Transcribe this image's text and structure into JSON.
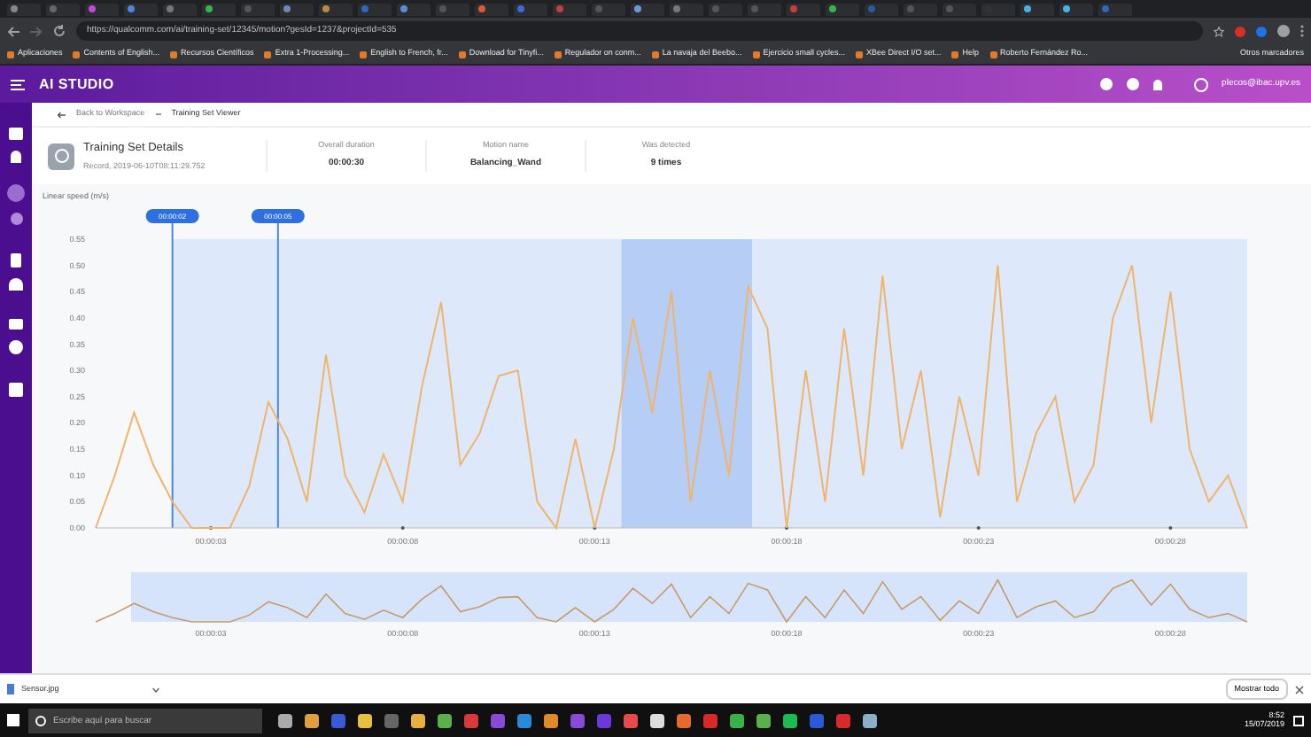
{
  "browser": {
    "url": "https://qualcomm.com/ai/training-set/12345/motion?gesId=1237&projectId=535",
    "bookmarks": [
      "Aplicaciones",
      "Contents of English...",
      "Recursos Científicos",
      "Extra 1-Processing...",
      "English to French, fr...",
      "Download for Tinyfi...",
      "Regulador on conm...",
      "La navaja del Beebo...",
      "Ejercicio small cycles...",
      "XBee Direct I/O set...",
      "Help",
      "Roberto Fernández Ro..."
    ],
    "other_bookmarks": "Otros marcadores"
  },
  "app": {
    "logo": "AI STUDIO",
    "user": "plecos@ibac.upv.es"
  },
  "breadcrumb": [
    "Back to Workspace",
    "Training Set Viewer"
  ],
  "details": {
    "title": "Training Set Details",
    "subtitle": "Record, 2019-06-10T08:11:29.752",
    "stats": [
      {
        "label": "Overall duration",
        "value": "00:00:30"
      },
      {
        "label": "Motion name",
        "value": "Balancing_Wand"
      },
      {
        "label": "Was detected",
        "value": "9 times"
      }
    ]
  },
  "chart": {
    "markers": [
      "00:00:02",
      "00:00:05"
    ],
    "chart_data": {
      "type": "line",
      "ylabel": "Linear speed (m/s)",
      "x": [
        0,
        0.5,
        1,
        1.5,
        2,
        2.5,
        3,
        3.5,
        4,
        4.5,
        5,
        5.5,
        6,
        6.5,
        7,
        7.5,
        8,
        8.5,
        9,
        9.5,
        10,
        10.5,
        11,
        11.5,
        12,
        12.5,
        13,
        13.5,
        14,
        14.5,
        15,
        15.5,
        16,
        16.5,
        17,
        17.5,
        18,
        18.5,
        19,
        19.5,
        20,
        20.5,
        21,
        21.5,
        22,
        22.5,
        23,
        23.5,
        24,
        24.5,
        25,
        25.5,
        26,
        26.5,
        27,
        27.5,
        28,
        28.5,
        29,
        29.5,
        30
      ],
      "series": [
        {
          "color": "#f0b46a",
          "values": [
            0,
            0.1,
            0.22,
            0.12,
            0.05,
            0,
            0,
            0,
            0.08,
            0.24,
            0.17,
            0.05,
            0.33,
            0.1,
            0.03,
            0.14,
            0.05,
            0.27,
            0.43,
            0.12,
            0.18,
            0.29,
            0.3,
            0.05,
            0,
            0.17,
            0,
            0.15,
            0.4,
            0.22,
            0.45,
            0.05,
            0.3,
            0.1,
            0.46,
            0.38,
            0,
            0.3,
            0.05,
            0.38,
            0.1,
            0.48,
            0.15,
            0.3,
            0.02,
            0.25,
            0.1,
            0.5,
            0.05,
            0.18,
            0.25,
            0.05,
            0.12,
            0.4,
            0.5,
            0.2,
            0.45,
            0.15,
            0.05,
            0.1,
            0
          ]
        }
      ],
      "xlim": [
        0,
        30
      ],
      "ylim": [
        0,
        0.55
      ],
      "xticks": [
        {
          "value": 3,
          "label": "00:00:03"
        },
        {
          "value": 8,
          "label": "00:00:08"
        },
        {
          "value": 13,
          "label": "00:00:13"
        },
        {
          "value": 18,
          "label": "00:00:18"
        },
        {
          "value": 23,
          "label": "00:00:23"
        },
        {
          "value": 28,
          "label": "00:00:28"
        }
      ],
      "yticks": [
        {
          "value": 0,
          "label": "0.00"
        },
        {
          "value": 0.05,
          "label": "0.05"
        },
        {
          "value": 0.1,
          "label": "0.10"
        },
        {
          "value": 0.15,
          "label": "0.15"
        },
        {
          "value": 0.2,
          "label": "0.20"
        },
        {
          "value": 0.25,
          "label": "0.25"
        },
        {
          "value": 0.3,
          "label": "0.30"
        },
        {
          "value": 0.35,
          "label": "0.35"
        },
        {
          "value": 0.4,
          "label": "0.40"
        },
        {
          "value": 0.45,
          "label": "0.45"
        },
        {
          "value": 0.5,
          "label": "0.50"
        },
        {
          "value": 0.55,
          "label": "0.55"
        }
      ]
    }
  },
  "overview": {
    "tick_labels": [
      "00:00:03",
      "00:00:08",
      "00:00:13",
      "00:00:18",
      "00:00:23",
      "00:00:28"
    ]
  },
  "downloads": {
    "file": "Sensor.jpg",
    "show_all": "Mostrar todo"
  },
  "taskbar": {
    "search_placeholder": "Escribe aquí para buscar",
    "time": "8:52",
    "date": "15/07/2019"
  }
}
